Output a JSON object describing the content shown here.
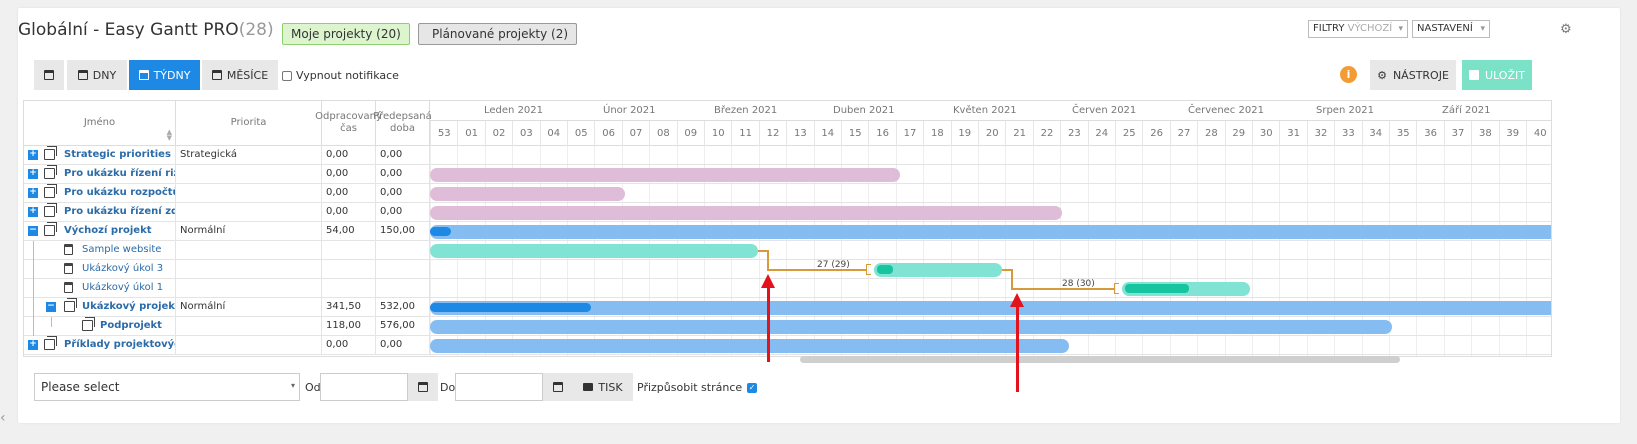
{
  "header": {
    "title": "Globální - Easy Gantt PRO",
    "count": "(28)",
    "my_projects": "Moje projekty (20)",
    "planned_projects": "Plánované projekty (2)",
    "filters_label": "FILTRY",
    "filters_value": "VÝCHOZÍ",
    "settings_label": "NASTAVENÍ"
  },
  "toolbar": {
    "days": "DNY",
    "weeks": "TÝDNY",
    "months": "MĚSÍCE",
    "notifications": "Vypnout notifikace",
    "tools": "NÁSTROJE",
    "save": "ULOŽIT",
    "info": "i"
  },
  "columns": {
    "name": "Jméno",
    "priority": "Priorita",
    "spent_line1": "Odpracovaný",
    "spent_line2": "čas",
    "estimated_line1": "Předepsaná",
    "estimated_line2": "doba"
  },
  "months": [
    "Leden 2021",
    "Únor 2021",
    "Březen 2021",
    "Duben 2021",
    "Květen 2021",
    "Červen 2021",
    "Červenec 2021",
    "Srpen 2021",
    "Září 2021"
  ],
  "weeks": [
    "53",
    "01",
    "02",
    "03",
    "04",
    "05",
    "06",
    "07",
    "08",
    "09",
    "10",
    "11",
    "12",
    "13",
    "14",
    "15",
    "16",
    "17",
    "18",
    "19",
    "20",
    "21",
    "22",
    "23",
    "24",
    "25",
    "26",
    "27",
    "28",
    "29",
    "30",
    "31",
    "32",
    "33",
    "34",
    "35",
    "36",
    "37",
    "38",
    "39",
    "40"
  ],
  "rows": [
    {
      "name": "Strategic priorities",
      "priority": "Strategická",
      "spent": "0,00",
      "estimated": "0,00"
    },
    {
      "name": "Pro ukázku řízení rizik",
      "priority": "",
      "spent": "0,00",
      "estimated": "0,00"
    },
    {
      "name": "Pro ukázku rozpočtů pro",
      "priority": "",
      "spent": "0,00",
      "estimated": "0,00"
    },
    {
      "name": "Pro ukázku řízení zdrojů",
      "priority": "",
      "spent": "0,00",
      "estimated": "0,00"
    },
    {
      "name": "Výchozí projekt",
      "priority": "Normální",
      "spent": "54,00",
      "estimated": "150,00"
    },
    {
      "name": "Sample website",
      "priority": "",
      "spent": "",
      "estimated": ""
    },
    {
      "name": "Ukázkový úkol 3",
      "priority": "",
      "spent": "",
      "estimated": ""
    },
    {
      "name": "Ukázkový úkol 1",
      "priority": "",
      "spent": "",
      "estimated": ""
    },
    {
      "name": "Ukázkový projekt",
      "priority": "Normální",
      "spent": "341,50",
      "estimated": "532,00"
    },
    {
      "name": "Podprojekt",
      "priority": "",
      "spent": "118,00",
      "estimated": "576,00"
    },
    {
      "name": "Příklady projektových t",
      "priority": "",
      "spent": "0,00",
      "estimated": "0,00"
    }
  ],
  "dependencies": {
    "first": "27 (29)",
    "second": "28 (30)"
  },
  "footer": {
    "select_placeholder": "Please select",
    "from": "Od",
    "to": "Do",
    "print": "TISK",
    "fit_page": "Přizpůsobit stránce"
  }
}
